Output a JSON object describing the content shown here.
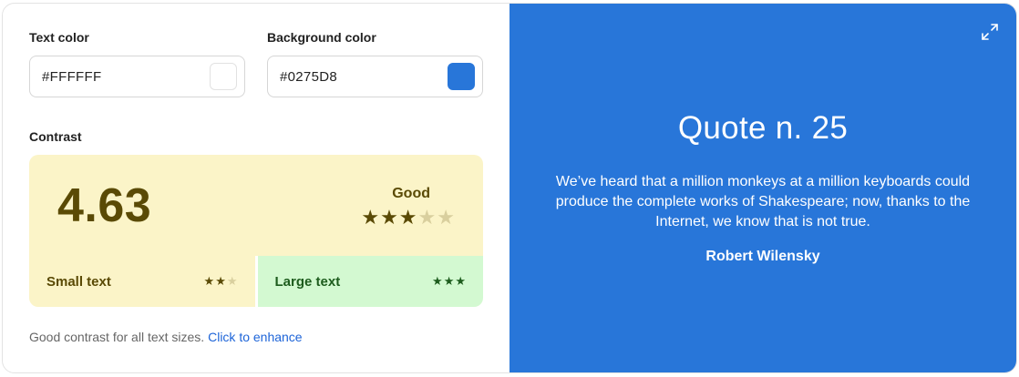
{
  "text_color": {
    "label": "Text color",
    "value": "#FFFFFF",
    "swatch": "#FFFFFF"
  },
  "background_color": {
    "label": "Background color",
    "value": "#0275D8",
    "swatch": "#2876D9"
  },
  "contrast": {
    "label": "Contrast",
    "ratio": "4.63",
    "rating": "Good",
    "stars": 3,
    "stars_max": 5,
    "small_text": {
      "label": "Small text",
      "stars": 2,
      "stars_max": 3
    },
    "large_text": {
      "label": "Large text",
      "stars": 3,
      "stars_max": 3
    }
  },
  "footer": {
    "message": "Good contrast for all text sizes.",
    "link": "Click to enhance"
  },
  "preview": {
    "title": "Quote n. 25",
    "quote": "We’ve heard that a million monkeys at a million keyboards could produce the complete works of Shakespeare; now, thanks to the Internet, we know that is not true.",
    "author": "Robert Wilensky",
    "icon": "expand-icon"
  },
  "colors": {
    "preview_bg": "#2876D9",
    "ratio_panel_bg": "#FBF4C8",
    "large_text_bg": "#D3F9D1",
    "link": "#1D64D8"
  }
}
